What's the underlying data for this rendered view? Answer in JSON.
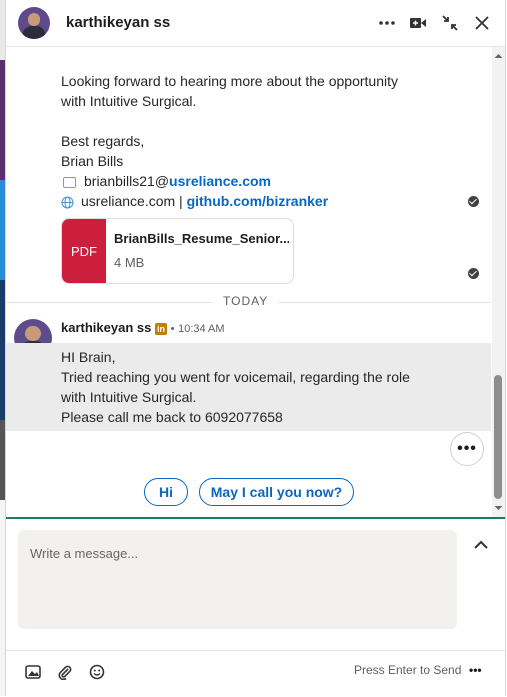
{
  "header": {
    "name": "karthikeyan ss",
    "more_icon": "ellipsis-icon",
    "video_icon": "video-call-icon",
    "collapse_icon": "minimize-icon",
    "close_icon": "close-icon"
  },
  "thread": {
    "earlier_lines": [
      "Looking forward to hearing more about the opportunity",
      "with Intuitive Surgical."
    ],
    "signoff": "Best regards,",
    "signer": "Brian Bills",
    "email_user": "brianbills21@",
    "email_domain": "usreliance.com",
    "site": "usreliance.com",
    "separator": "|",
    "github": "github.com/bizranker",
    "attachment": {
      "badge": "PDF",
      "name": "BrianBills_Resume_Senior...",
      "size": "4 MB"
    },
    "divider": "TODAY",
    "message": {
      "sender": "karthikeyan ss",
      "badge_icon": "linkedin-icon",
      "dot": "•",
      "time": "10:34 AM",
      "lines": [
        "HI Brain,",
        "Tried reaching you went for voicemail, regarding the role",
        "with Intuitive Surgical.",
        "Please call me back to 6092077658"
      ]
    },
    "more_options": "•••"
  },
  "quick_replies": [
    "Hi",
    "May I call you now?"
  ],
  "compose": {
    "placeholder": "Write a message...",
    "expand_icon": "chevron-up-icon"
  },
  "footer": {
    "image_icon": "image-icon",
    "attach_icon": "paperclip-icon",
    "emoji_icon": "emoji-icon",
    "hint": "Press Enter to Send",
    "more": "•••"
  },
  "colors": {
    "accent": "#0a66c2",
    "pdf": "#cc1f3e",
    "linkedin": "#c27c00",
    "compose_line": "#1b7f54"
  }
}
